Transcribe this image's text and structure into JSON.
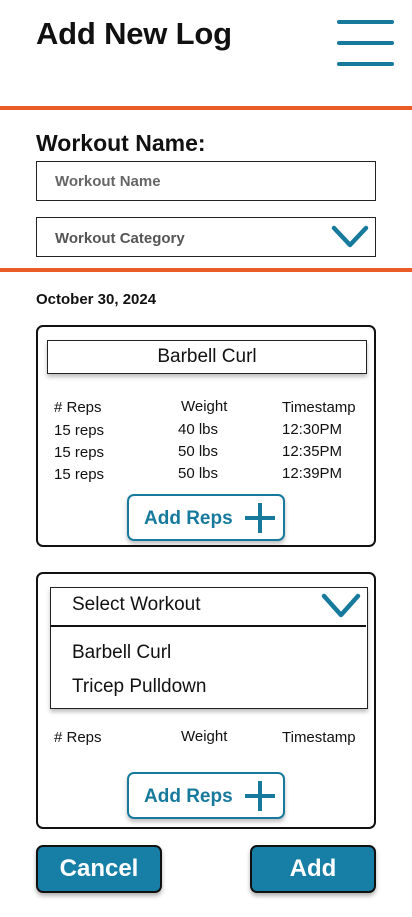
{
  "header": {
    "title": "Add New Log",
    "menu_icon": "hamburger-menu-icon"
  },
  "form": {
    "section_label": "Workout Name:",
    "workout_name": {
      "placeholder": "Workout Name",
      "value": ""
    },
    "workout_category": {
      "placeholder": "Workout Category"
    }
  },
  "date": "October 30, 2024",
  "logs": [
    {
      "exercise": "Barbell Curl",
      "columns": [
        "# Reps",
        "Weight",
        "Timestamp"
      ],
      "rows": [
        [
          "15 reps",
          "40 lbs",
          "12:30PM"
        ],
        [
          "15 reps",
          "50 lbs",
          "12:35PM"
        ],
        [
          "15 reps",
          "50 lbs",
          "12:39PM"
        ]
      ],
      "add_reps_label": "Add Reps"
    },
    {
      "select_label": "Select Workout",
      "options": [
        "Barbell Curl",
        "Tricep Pulldown"
      ],
      "columns": [
        "# Reps",
        "Weight",
        "Timestamp"
      ],
      "rows": [],
      "add_reps_label": "Add Reps"
    }
  ],
  "actions": {
    "cancel_label": "Cancel",
    "add_label": "Add"
  },
  "colors": {
    "accent": "#177a9c",
    "divider": "#ea5b25",
    "button_fill": "#177fa6"
  }
}
